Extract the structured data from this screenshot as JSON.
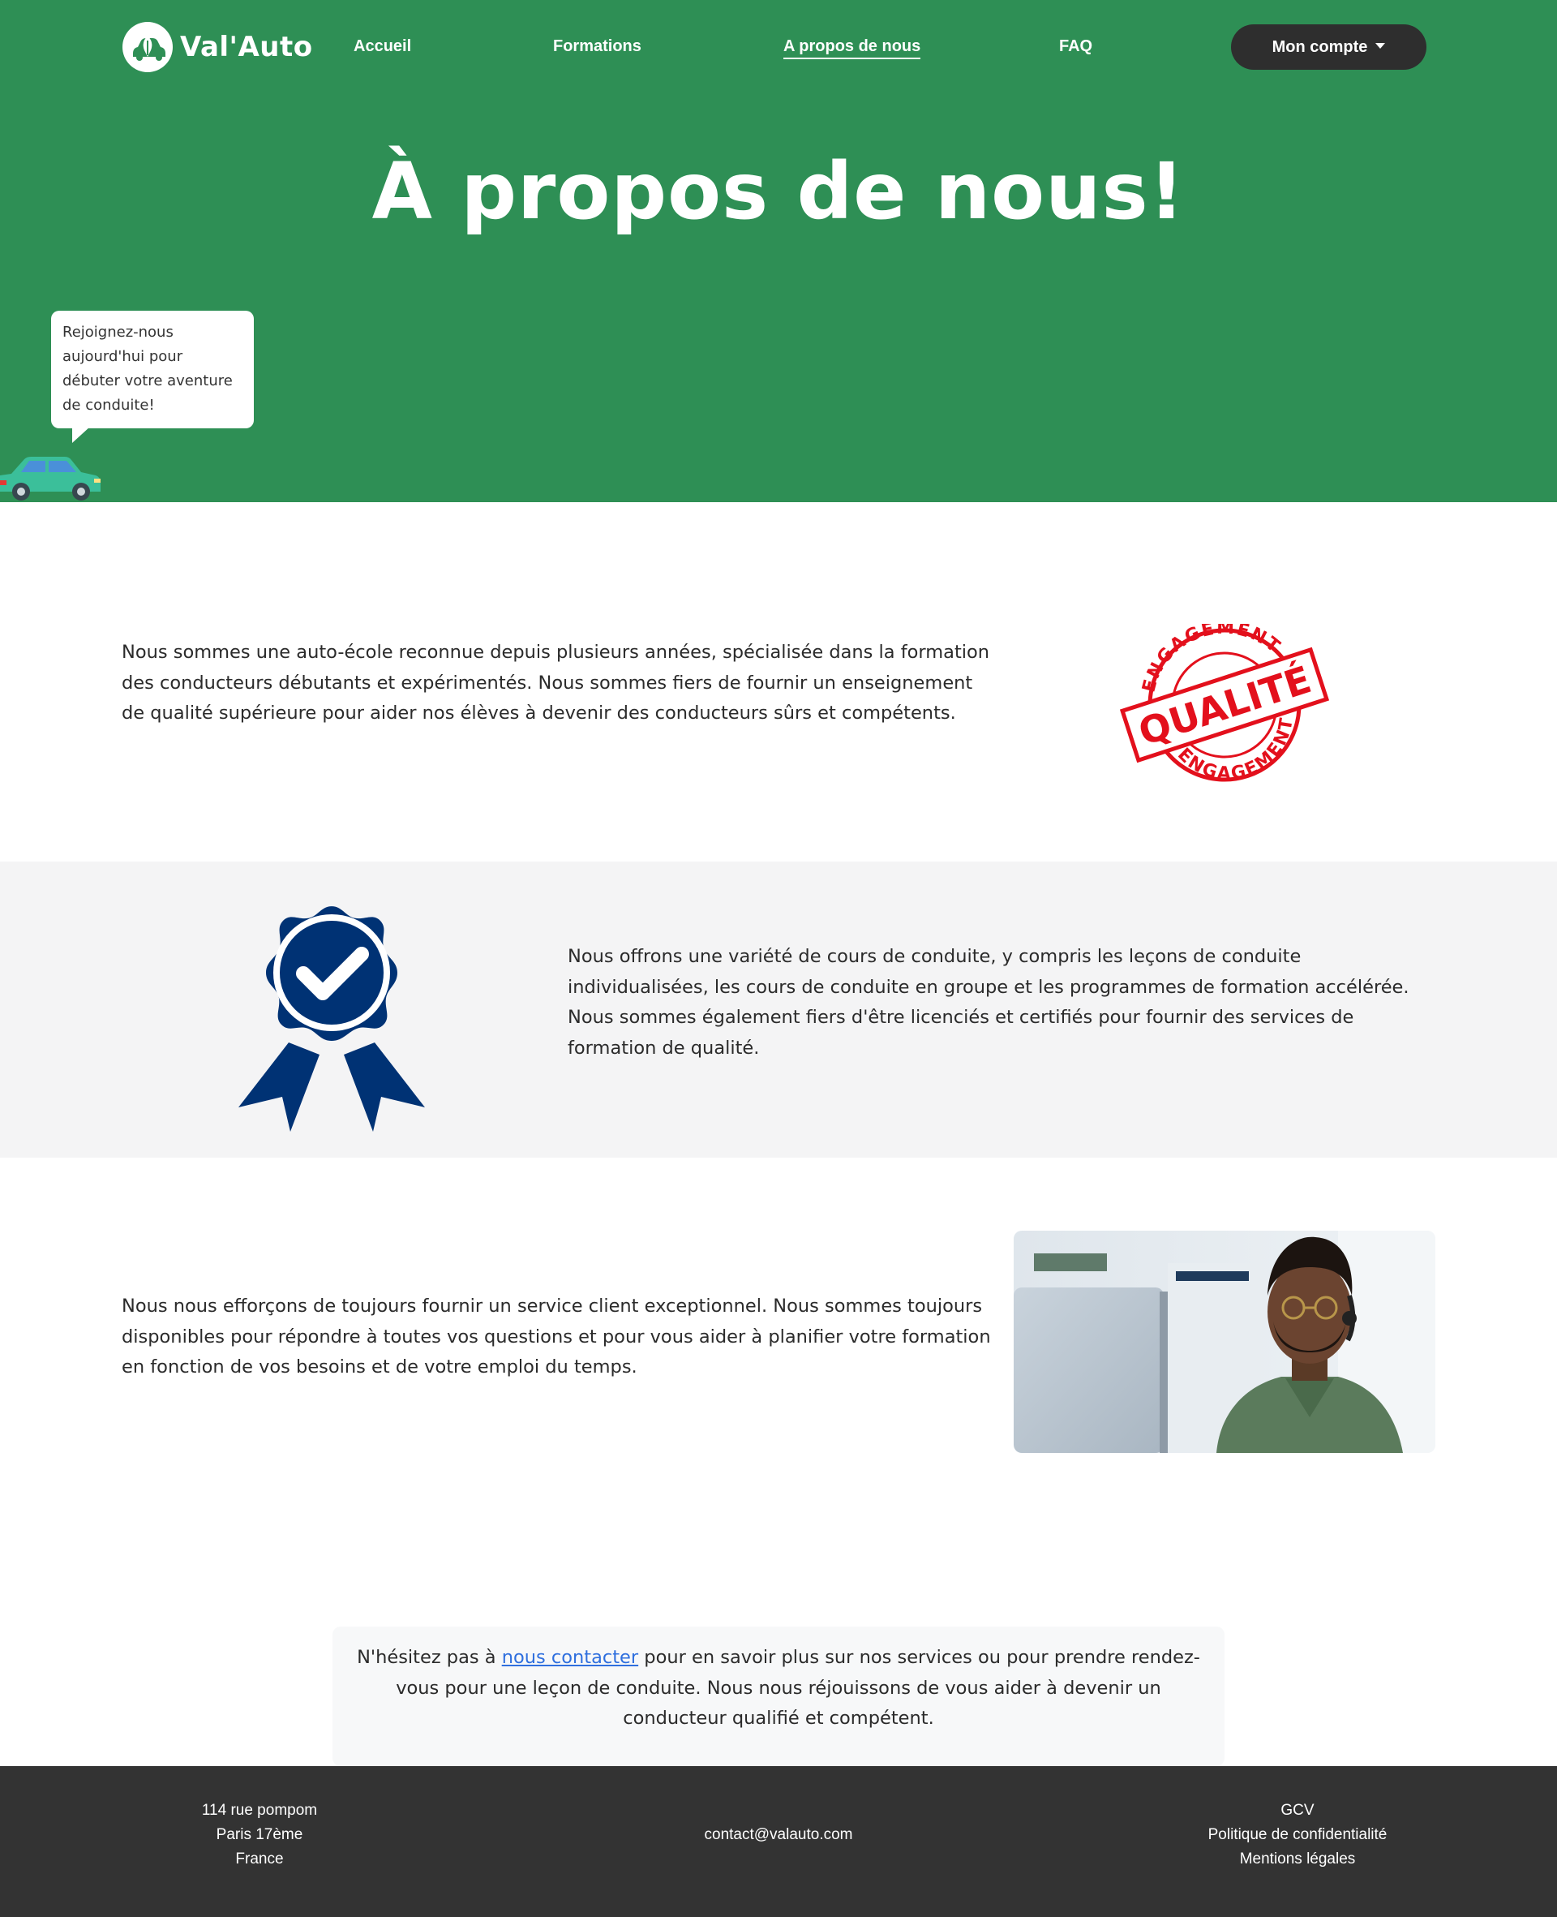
{
  "header": {
    "brand_name": "Val'Auto",
    "nav": {
      "home": "Accueil",
      "courses": "Formations",
      "about": "A propos de nous",
      "faq": "FAQ"
    },
    "account_label": "Mon compte",
    "title": "À propos de nous!",
    "bubble_text": "Rejoignez-nous aujourd'hui pour débuter votre aventure de conduite!"
  },
  "sections": {
    "intro_text": "Nous sommes une auto-école reconnue depuis plusieurs années, spécialisée dans la formation des conducteurs débutants et expérimentés. Nous sommes fiers de fournir un enseignement de qualité supérieure pour aider nos élèves à devenir des conducteurs sûrs et compétents.",
    "stamp": {
      "word_top": "ENGAGEMENT",
      "word_center": "QUALITÉ",
      "word_bottom": "ENGAGEMENT"
    },
    "courses_text": "Nous offrons une variété de cours de conduite, y compris les leçons de conduite individualisées, les cours de conduite en groupe et les programmes de formation accélérée. Nous sommes également fiers d'être licenciés et certifiés pour fournir des services de formation de qualité.",
    "service_text": "Nous nous efforçons de toujours fournir un service client exceptionnel. Nous sommes toujours disponibles pour répondre à toutes vos questions et pour vous aider à planifier votre formation en fonction de vos besoins et de votre emploi du temps."
  },
  "contact": {
    "before_link": "N'hésitez pas à ",
    "link_text": "nous contacter",
    "after_link": " pour en savoir plus sur nos services ou pour prendre rendez-vous pour une leçon de conduite. Nous nous réjouissons de vous aider à devenir un conducteur qualifié et compétent."
  },
  "footer": {
    "address_line1": "114 rue pompom",
    "address_line2": "Paris 17ème",
    "address_line3": "France",
    "email": "contact@valauto.com",
    "link_terms": "GCV",
    "link_privacy": "Politique de confidentialité",
    "link_legal": "Mentions légales"
  },
  "colors": {
    "brand_green": "#2e8f55",
    "dark": "#2e2e2e",
    "stamp_red": "#e3101c",
    "badge_navy": "#003274",
    "link_blue": "#2f6fde"
  },
  "icons": {
    "logo": "leaf-car-logo-icon",
    "account_caret": "caret-down-icon",
    "car": "car-icon",
    "stamp": "quality-stamp-icon",
    "badge": "award-ribbon-check-icon"
  }
}
